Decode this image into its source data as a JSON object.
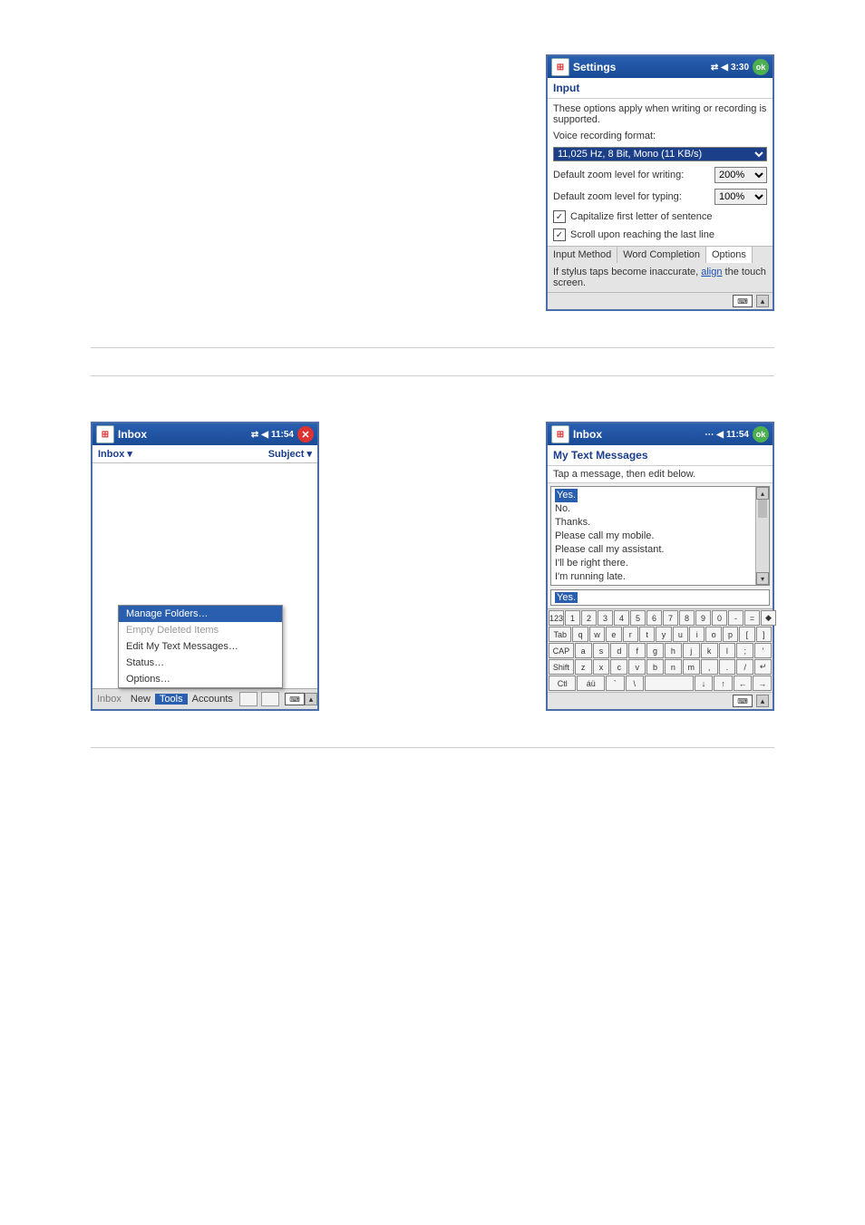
{
  "settings_screen": {
    "title": "Settings",
    "time": "3:30",
    "ok_label": "ok",
    "heading": "Input",
    "intro": "These options apply when writing or recording is supported.",
    "voice_label": "Voice recording format:",
    "voice_value": "11,025 Hz, 8 Bit, Mono (11 KB/s)",
    "zoom_write_label": "Default zoom level for writing:",
    "zoom_write_value": "200%",
    "zoom_type_label": "Default zoom level for typing:",
    "zoom_type_value": "100%",
    "cap_label": "Capitalize first letter of sentence",
    "scroll_label": "Scroll upon reaching the last line",
    "tabs": [
      "Input Method",
      "Word Completion",
      "Options"
    ],
    "active_tab_index": 2,
    "hint_pre": "If stylus taps become inaccurate, ",
    "hint_link": "align",
    "hint_post": " the touch screen."
  },
  "inbox_menu_screen": {
    "title": "Inbox",
    "time": "11:54",
    "close_glyph": "✕",
    "folder_label": "Inbox ▾",
    "sort_label": "Subject ▾",
    "popup_items": [
      {
        "label": "Manage Folders…",
        "state": "highlight"
      },
      {
        "label": "Empty Deleted Items",
        "state": "disabled"
      },
      {
        "label": "Edit My Text Messages…",
        "state": "normal"
      },
      {
        "label": "Status…",
        "state": "normal"
      },
      {
        "label": "Options…",
        "state": "normal"
      }
    ],
    "menubar": {
      "inbox": "Inbox",
      "new": "New",
      "tools": "Tools",
      "accounts": "Accounts"
    }
  },
  "mytextmsg_screen": {
    "title": "Inbox",
    "time": "11:54",
    "ok_label": "ok",
    "heading": "My Text Messages",
    "hint": "Tap a message, then edit below.",
    "list_selected": "Yes.",
    "list_items": [
      "No.",
      "Thanks.",
      "Please call my mobile.",
      "Please call my assistant.",
      "I'll be right there.",
      "I'm running late."
    ],
    "edit_value": "Yes.",
    "keyboard": {
      "row1": [
        "123",
        "1",
        "2",
        "3",
        "4",
        "5",
        "6",
        "7",
        "8",
        "9",
        "0",
        "-",
        "=",
        "◆"
      ],
      "row2": [
        "Tab",
        "q",
        "w",
        "e",
        "r",
        "t",
        "y",
        "u",
        "i",
        "o",
        "p",
        "[",
        "]"
      ],
      "row3": [
        "CAP",
        "a",
        "s",
        "d",
        "f",
        "g",
        "h",
        "j",
        "k",
        "l",
        ";",
        "'"
      ],
      "row4": [
        "Shift",
        "z",
        "x",
        "c",
        "v",
        "b",
        "n",
        "m",
        ",",
        ".",
        "/",
        "↵"
      ],
      "row5": [
        "Ctl",
        "áü",
        "`",
        "\\",
        "",
        "↓",
        "↑",
        "←",
        "→"
      ]
    }
  }
}
